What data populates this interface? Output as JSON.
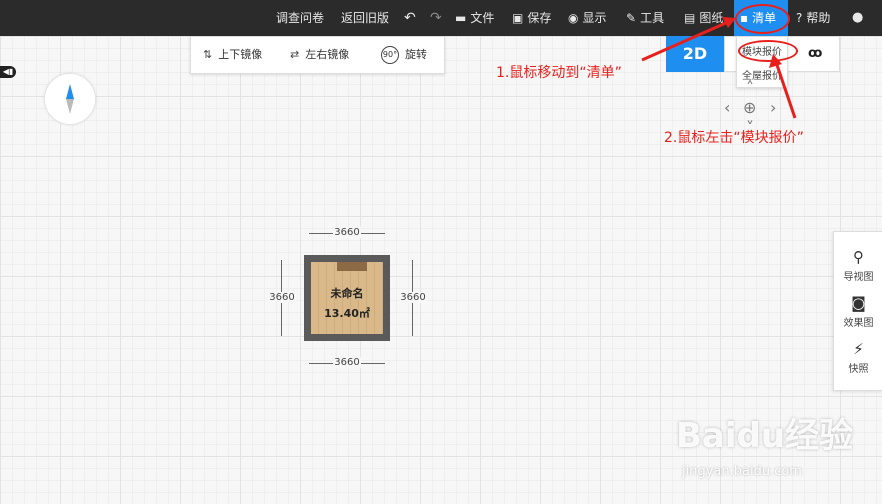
{
  "topbar": {
    "survey": "调查问卷",
    "back_old": "返回旧版",
    "file": "文件",
    "save": "保存",
    "display": "显示",
    "tools": "工具",
    "drawings": "图纸",
    "list": "清单",
    "help": "帮助"
  },
  "mirror_toolbar": {
    "flip_vertical": "上下镜像",
    "flip_horizontal": "左右镜像",
    "rotate_badge": "90°",
    "rotate": "旋转"
  },
  "view": {
    "two_d": "2D"
  },
  "dropdown": {
    "module_quote": "模块报价",
    "full_quote": "全屋报价"
  },
  "room": {
    "name": "未命名",
    "area": "13.40㎡",
    "dim_top": "3660",
    "dim_bottom": "3660",
    "dim_left": "3660",
    "dim_right": "3660"
  },
  "right_panel": {
    "nav_view": "导视图",
    "render": "效果图",
    "snapshot": "快照"
  },
  "annotations": {
    "step1": "1.鼠标移动到“清单”",
    "step2": "2.鼠标左击“模块报价”",
    "color": "#e8201c"
  },
  "watermark": {
    "logo": "Baidu经验",
    "url": "jingyan.baidu.com"
  },
  "colors": {
    "accent": "#1e8ff0",
    "topbar": "#2b2b2b"
  },
  "icons": [
    "undo-icon",
    "redo-icon",
    "folder-icon",
    "save-icon",
    "eye-icon",
    "wrench-icon",
    "map-icon",
    "list-icon",
    "help-icon",
    "user-icon",
    "compass-icon",
    "pan-left-icon",
    "pan-right-icon",
    "pan-center-icon",
    "camera-icon",
    "snapshot-icon"
  ]
}
